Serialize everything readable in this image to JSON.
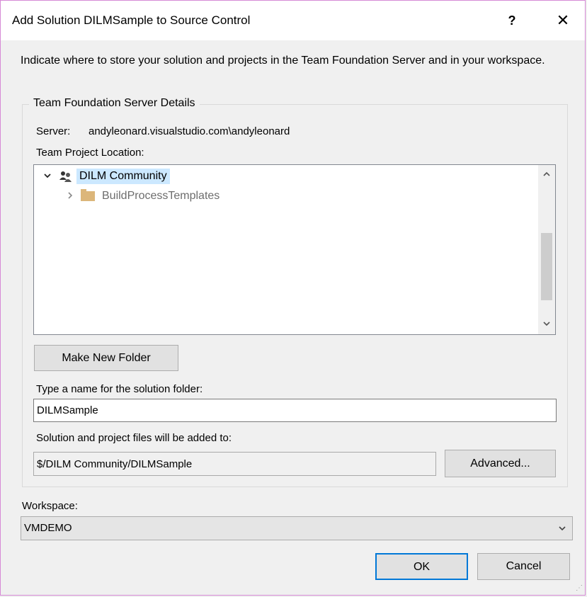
{
  "title": "Add Solution DILMSample to Source Control",
  "titlebar_buttons": {
    "help": "?",
    "close": "✕"
  },
  "instructions": "Indicate where to store your solution and projects in the Team Foundation Server and in your workspace.",
  "tfs": {
    "group_title": "Team Foundation Server Details",
    "server_label": "Server:",
    "server_value": "andyleonard.visualstudio.com\\andyleonard",
    "location_label": "Team Project Location:",
    "tree": {
      "root": {
        "label": "DILM Community",
        "icon": "team-project-icon",
        "expanded": true,
        "selected": true
      },
      "children": [
        {
          "label": "BuildProcessTemplates",
          "icon": "folder-icon",
          "expanded": false
        }
      ]
    },
    "make_folder_label": "Make New Folder",
    "folder_name_label": "Type a name for the solution folder:",
    "folder_name_value": "DILMSample",
    "path_label": "Solution and project files will be added to:",
    "path_value": "$/DILM Community/DILMSample",
    "advanced_label": "Advanced..."
  },
  "workspace": {
    "label": "Workspace:",
    "selected": "VMDEMO"
  },
  "buttons": {
    "ok": "OK",
    "cancel": "Cancel"
  },
  "colors": {
    "selection": "#cce8ff",
    "accent": "#0078d7",
    "folder": "#dcb67a"
  }
}
